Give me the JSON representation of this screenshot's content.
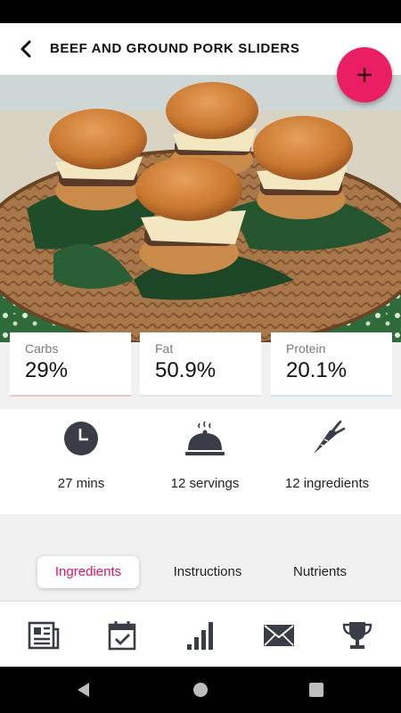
{
  "header": {
    "title": "BEEF AND GROUND PORK SLIDERS"
  },
  "macros": [
    {
      "label": "Carbs",
      "value": "29%",
      "accent": "#f3c6c6"
    },
    {
      "label": "Fat",
      "value": "50.9%",
      "accent": "#e6e6e6"
    },
    {
      "label": "Protein",
      "value": "20.1%",
      "accent": "#cde6f7"
    }
  ],
  "info": [
    {
      "icon": "clock-icon",
      "label": "27 mins"
    },
    {
      "icon": "serving-cloche-icon",
      "label": "12 servings"
    },
    {
      "icon": "carrot-icon",
      "label": "12 ingredients"
    }
  ],
  "tabs": [
    {
      "label": "Ingredients",
      "active": true
    },
    {
      "label": "Instructions",
      "active": false
    },
    {
      "label": "Nutrients",
      "active": false
    }
  ],
  "bottom_nav": [
    {
      "icon": "newspaper-icon"
    },
    {
      "icon": "calendar-check-icon"
    },
    {
      "icon": "bar-chart-icon"
    },
    {
      "icon": "mail-icon"
    },
    {
      "icon": "trophy-icon"
    }
  ],
  "colors": {
    "accent": "#e91e63",
    "tab_active": "#e0185a"
  }
}
